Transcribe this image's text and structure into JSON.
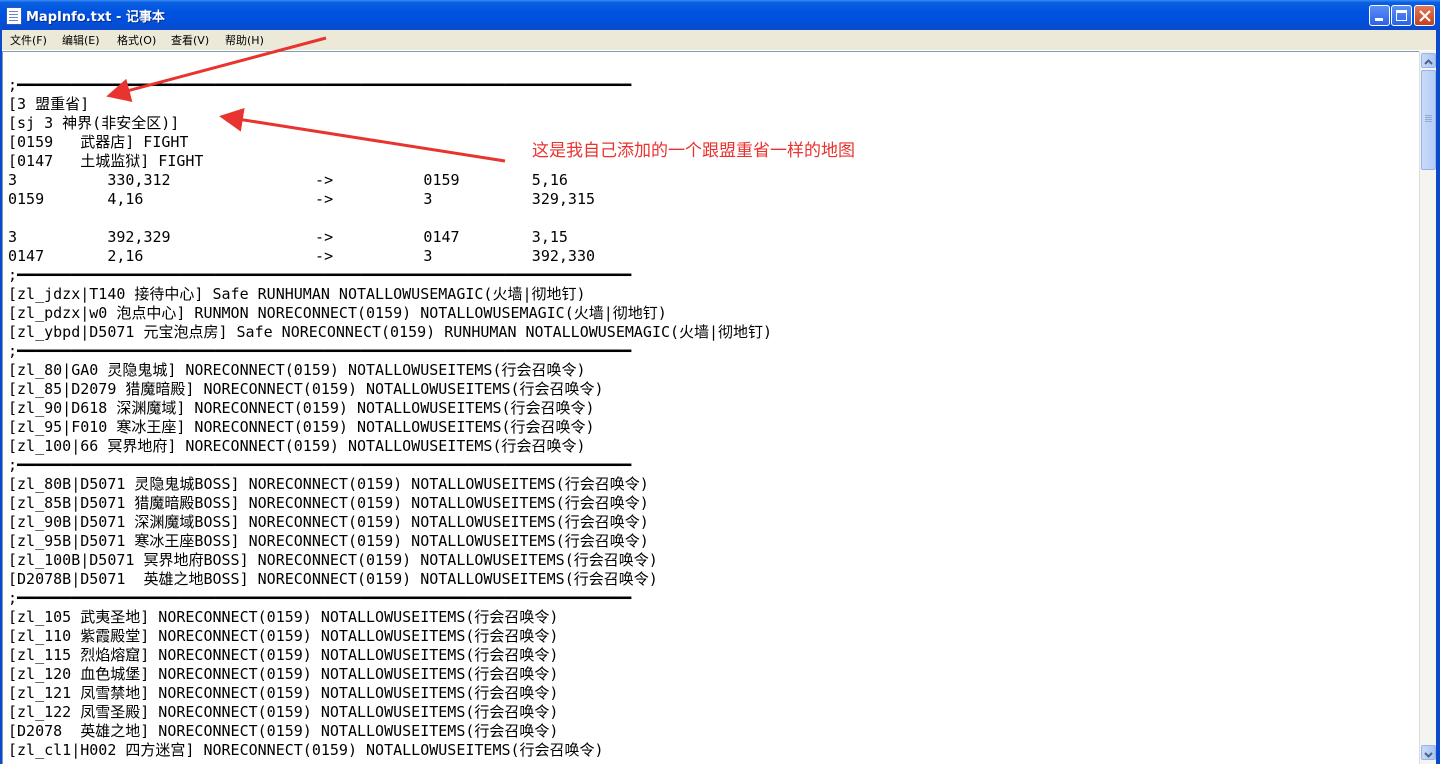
{
  "window": {
    "title": "MapInfo.txt - 记事本",
    "minimize_label": "_",
    "maximize_label": "□",
    "close_label": "✕"
  },
  "menu": {
    "items": [
      "文件(F)",
      "编辑(E)",
      "格式(O)",
      "查看(V)",
      "帮助(H)"
    ]
  },
  "editor": {
    "lines": [
      ";━━━━━━━━━━━━━━━━━━━━━━━━━━━━━━━━━━━━━━━━━━━━━━━━━━━━━━━━━━━━━━━━━━━━",
      "[3 盟重省]",
      "[sj 3 神界(非安全区)]",
      "[0159   武器店] FIGHT",
      "[0147   土城监狱] FIGHT",
      "3          330,312                ->          0159        5,16",
      "0159       4,16                   ->          3           329,315",
      "",
      "3          392,329                ->          0147        3,15",
      "0147       2,16                   ->          3           392,330",
      ";━━━━━━━━━━━━━━━━━━━━━━━━━━━━━━━━━━━━━━━━━━━━━━━━━━━━━━━━━━━━━━━━━━━━",
      "[zl_jdzx|T140 接待中心] Safe RUNHUMAN NOTALLOWUSEMAGIC(火墙|彻地钉)",
      "[zl_pdzx|w0 泡点中心] RUNMON NORECONNECT(0159) NOTALLOWUSEMAGIC(火墙|彻地钉)",
      "[zl_ybpd|D5071 元宝泡点房] Safe NORECONNECT(0159) RUNHUMAN NOTALLOWUSEMAGIC(火墙|彻地钉)",
      ";━━━━━━━━━━━━━━━━━━━━━━━━━━━━━━━━━━━━━━━━━━━━━━━━━━━━━━━━━━━━━━━━━━━━",
      "[zl_80|GA0 灵隐鬼城] NORECONNECT(0159) NOTALLOWUSEITEMS(行会召唤令)",
      "[zl_85|D2079 猎魔暗殿] NORECONNECT(0159) NOTALLOWUSEITEMS(行会召唤令)",
      "[zl_90|D618 深渊魔域] NORECONNECT(0159) NOTALLOWUSEITEMS(行会召唤令)",
      "[zl_95|F010 寒冰王座] NORECONNECT(0159) NOTALLOWUSEITEMS(行会召唤令)",
      "[zl_100|66 冥界地府] NORECONNECT(0159) NOTALLOWUSEITEMS(行会召唤令)",
      ";━━━━━━━━━━━━━━━━━━━━━━━━━━━━━━━━━━━━━━━━━━━━━━━━━━━━━━━━━━━━━━━━━━━━",
      "[zl_80B|D5071 灵隐鬼城BOSS] NORECONNECT(0159) NOTALLOWUSEITEMS(行会召唤令)",
      "[zl_85B|D5071 猎魔暗殿BOSS] NORECONNECT(0159) NOTALLOWUSEITEMS(行会召唤令)",
      "[zl_90B|D5071 深渊魔域BOSS] NORECONNECT(0159) NOTALLOWUSEITEMS(行会召唤令)",
      "[zl_95B|D5071 寒冰王座BOSS] NORECONNECT(0159) NOTALLOWUSEITEMS(行会召唤令)",
      "[zl_100B|D5071 冥界地府BOSS] NORECONNECT(0159) NOTALLOWUSEITEMS(行会召唤令)",
      "[D2078B|D5071  英雄之地BOSS] NORECONNECT(0159) NOTALLOWUSEITEMS(行会召唤令)",
      ";━━━━━━━━━━━━━━━━━━━━━━━━━━━━━━━━━━━━━━━━━━━━━━━━━━━━━━━━━━━━━━━━━━━━",
      "[zl_105 武夷圣地] NORECONNECT(0159) NOTALLOWUSEITEMS(行会召唤令)",
      "[zl_110 紫霞殿堂] NORECONNECT(0159) NOTALLOWUSEITEMS(行会召唤令)",
      "[zl_115 烈焰熔窟] NORECONNECT(0159) NOTALLOWUSEITEMS(行会召唤令)",
      "[zl_120 血色城堡] NORECONNECT(0159) NOTALLOWUSEITEMS(行会召唤令)",
      "[zl_121 凤雪禁地] NORECONNECT(0159) NOTALLOWUSEITEMS(行会召唤令)",
      "[zl_122 凤雪圣殿] NORECONNECT(0159) NOTALLOWUSEITEMS(行会召唤令)",
      "[D2078  英雄之地] NORECONNECT(0159) NOTALLOWUSEITEMS(行会召唤令)",
      "[zl_cl1|H002 四方迷宫] NORECONNECT(0159) NOTALLOWUSEITEMS(行会召唤令)"
    ]
  },
  "annotation": {
    "text": "这是我自己添加的一个跟盟重省一样的地图",
    "color": "#E8332F"
  },
  "colors": {
    "titlebar": "#0053E1",
    "menubar": "#ECE9D8",
    "annotation": "#E8332F"
  }
}
